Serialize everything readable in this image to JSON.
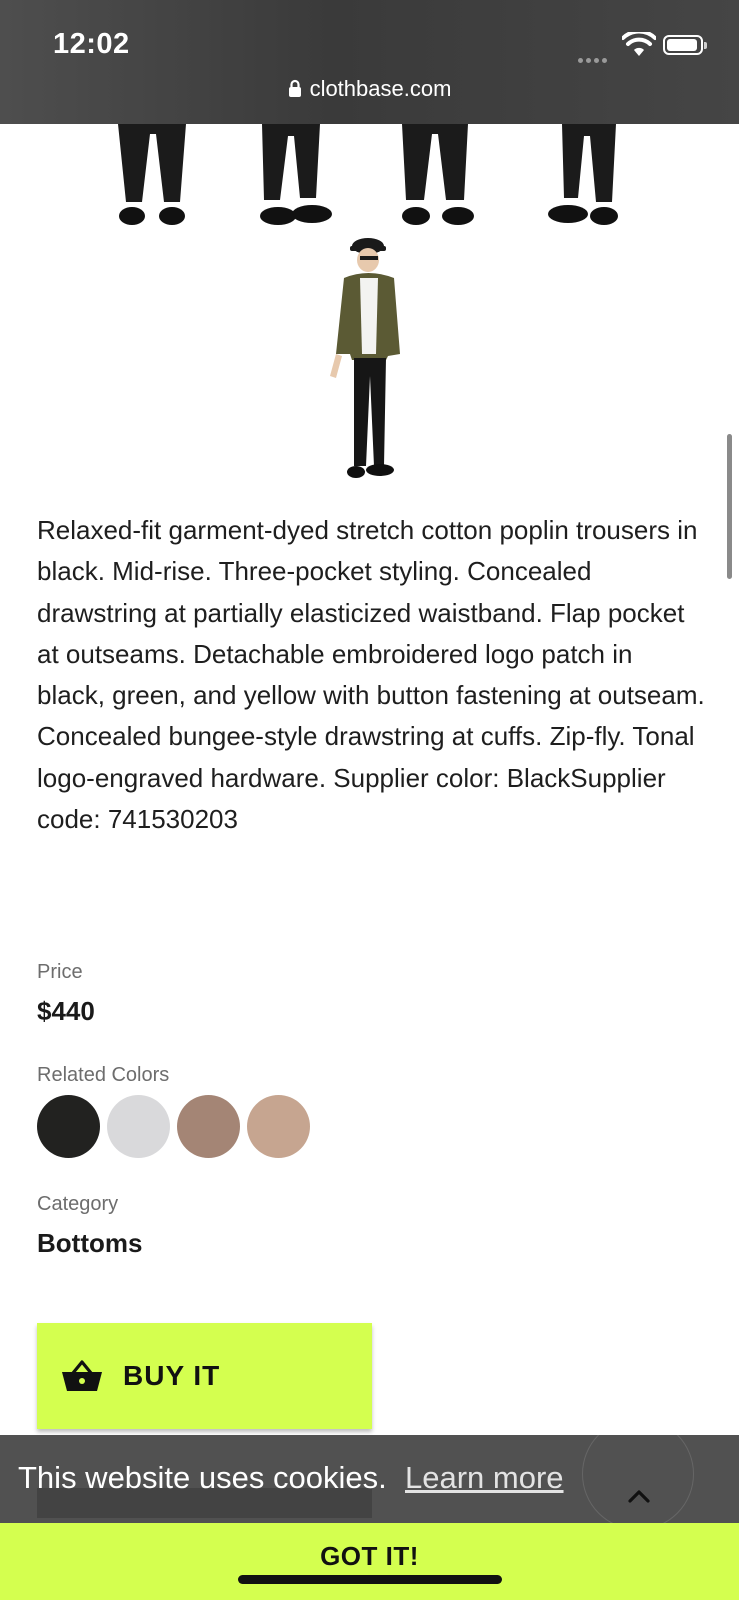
{
  "status_bar": {
    "time": "12:02",
    "url": "clothbase.com"
  },
  "product": {
    "description": "Relaxed-fit garment-dyed stretch cotton poplin trousers in black. Mid-rise. Three-pocket styling. Concealed drawstring at partially elasticized waistband. Flap pocket at outseams. Detachable embroidered logo patch in black, green, and yellow with button fastening at outseam. Concealed bungee-style drawstring at cuffs. Zip-fly. Tonal logo-engraved hardware. Supplier color: BlackSupplier code: 741530203",
    "price_label": "Price",
    "price": "$440",
    "related_colors_label": "Related Colors",
    "related_colors": [
      "#222220",
      "#d9d9db",
      "#a48575",
      "#c6a590"
    ],
    "category_label": "Category",
    "category": "Bottoms",
    "buy_label": "BUY IT"
  },
  "cookie_bar": {
    "text": "This website uses cookies.",
    "learn_more": "Learn more",
    "accept": "GOT IT!"
  },
  "colors": {
    "accent": "#d4ff4f",
    "status_bar": "#454545"
  }
}
